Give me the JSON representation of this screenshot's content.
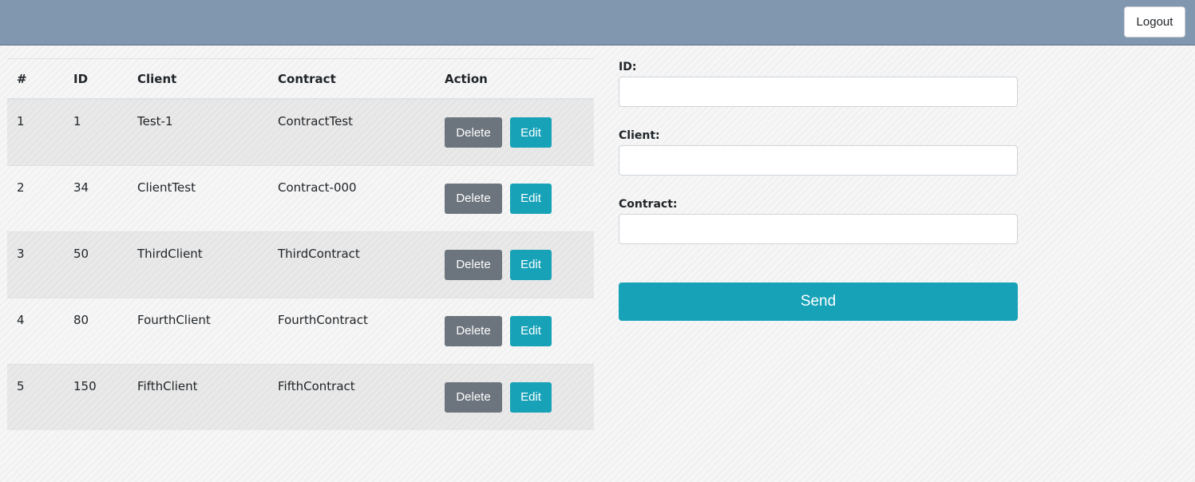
{
  "header": {
    "logout_label": "Logout"
  },
  "table": {
    "columns": [
      "#",
      "ID",
      "Client",
      "Contract",
      "Action"
    ],
    "rows": [
      {
        "num": "1",
        "id": "1",
        "client": "Test-1",
        "contract": "ContractTest"
      },
      {
        "num": "2",
        "id": "34",
        "client": "ClientTest",
        "contract": "Contract-000"
      },
      {
        "num": "3",
        "id": "50",
        "client": "ThirdClient",
        "contract": "ThirdContract"
      },
      {
        "num": "4",
        "id": "80",
        "client": "FourthClient",
        "contract": "FourthContract"
      },
      {
        "num": "5",
        "id": "150",
        "client": "FifthClient",
        "contract": "FifthContract"
      }
    ],
    "delete_label": "Delete",
    "edit_label": "Edit"
  },
  "form": {
    "id_label": "ID:",
    "id_value": "",
    "client_label": "Client:",
    "client_value": "",
    "contract_label": "Contract:",
    "contract_value": "",
    "send_label": "Send"
  },
  "colors": {
    "header_bg": "#8097af",
    "delete_button": "#6c757d",
    "edit_button": "#17a2b8",
    "send_button": "#17a2b8"
  }
}
